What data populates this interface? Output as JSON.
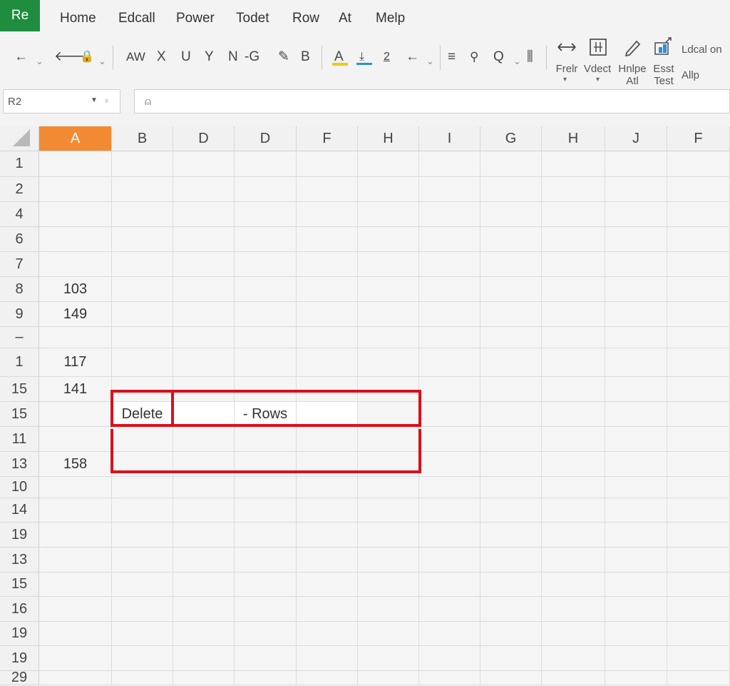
{
  "app": {
    "badge": "Re"
  },
  "menu": {
    "items": [
      "Home",
      "Edcall",
      "Power",
      "Todet",
      "Row",
      "At",
      "Melp"
    ]
  },
  "toolbar": {
    "glyphs": [
      "←",
      "⌄",
      "🡐",
      "🔒",
      "⌄",
      "AW",
      "X",
      "U",
      "Y",
      "N",
      "-G",
      "✎",
      "B",
      "A",
      "⤓",
      "2",
      "←",
      "⌄",
      "≡",
      "⚲",
      "Q",
      "⌄",
      "⫼"
    ],
    "right_captions": [
      {
        "icon": "resize-arrows-icon",
        "label": "Frelr"
      },
      {
        "icon": "grid-box-icon",
        "label": "Vdect"
      },
      {
        "icon": "pen-icon",
        "label": "Hnlpe\nAtl"
      },
      {
        "icon": "chart-box-icon",
        "label": "Esst\nTest"
      },
      {
        "icon": "",
        "label": "Ldcal on\nAllp"
      }
    ],
    "accent_yellow": "#f2c811",
    "accent_blue": "#2d8fd5"
  },
  "formula_bar": {
    "name_box": "R2",
    "fx_symbol": "⸗",
    "formula_icon": "⍝",
    "value": ""
  },
  "grid": {
    "columns": [
      "A",
      "B",
      "D",
      "D",
      "F",
      "H",
      "I",
      "G",
      "H",
      "J",
      "F"
    ],
    "selected_column": "A",
    "rows": [
      "1",
      "2",
      "4",
      "6",
      "7",
      "8",
      "9",
      "–",
      "1",
      "15",
      "15",
      "11",
      "13",
      "10",
      "14",
      "19",
      "13",
      "15",
      "16",
      "19",
      "19",
      "29"
    ],
    "column_a_values": [
      "",
      "",
      "",
      "",
      "",
      "103",
      "149",
      "",
      "117",
      "141",
      "",
      "",
      "158",
      "",
      "",
      "",
      "",
      "",
      "",
      "",
      "",
      ""
    ],
    "highlight_row": {
      "label_1": "Delete",
      "label_2": "- Rows"
    }
  },
  "colors": {
    "header_selected": "#f28a34",
    "frame_red": "#d9101a",
    "badge_green": "#1e8e3e"
  }
}
